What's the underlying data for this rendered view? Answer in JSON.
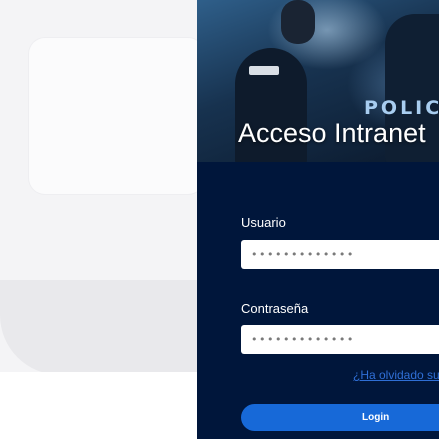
{
  "hero": {
    "brand_text": "POLIC",
    "title": "Acceso Intranet"
  },
  "form": {
    "username_label": "Usuario",
    "username_value": "•••••••••••••",
    "password_label": "Contraseña",
    "password_value": "•••••••••••••",
    "forgot_link": "¿Ha olvidado su",
    "login_label": "Login"
  },
  "colors": {
    "panel_background": "#00163b",
    "button": "#1769d8",
    "link": "#2f6fd6"
  }
}
